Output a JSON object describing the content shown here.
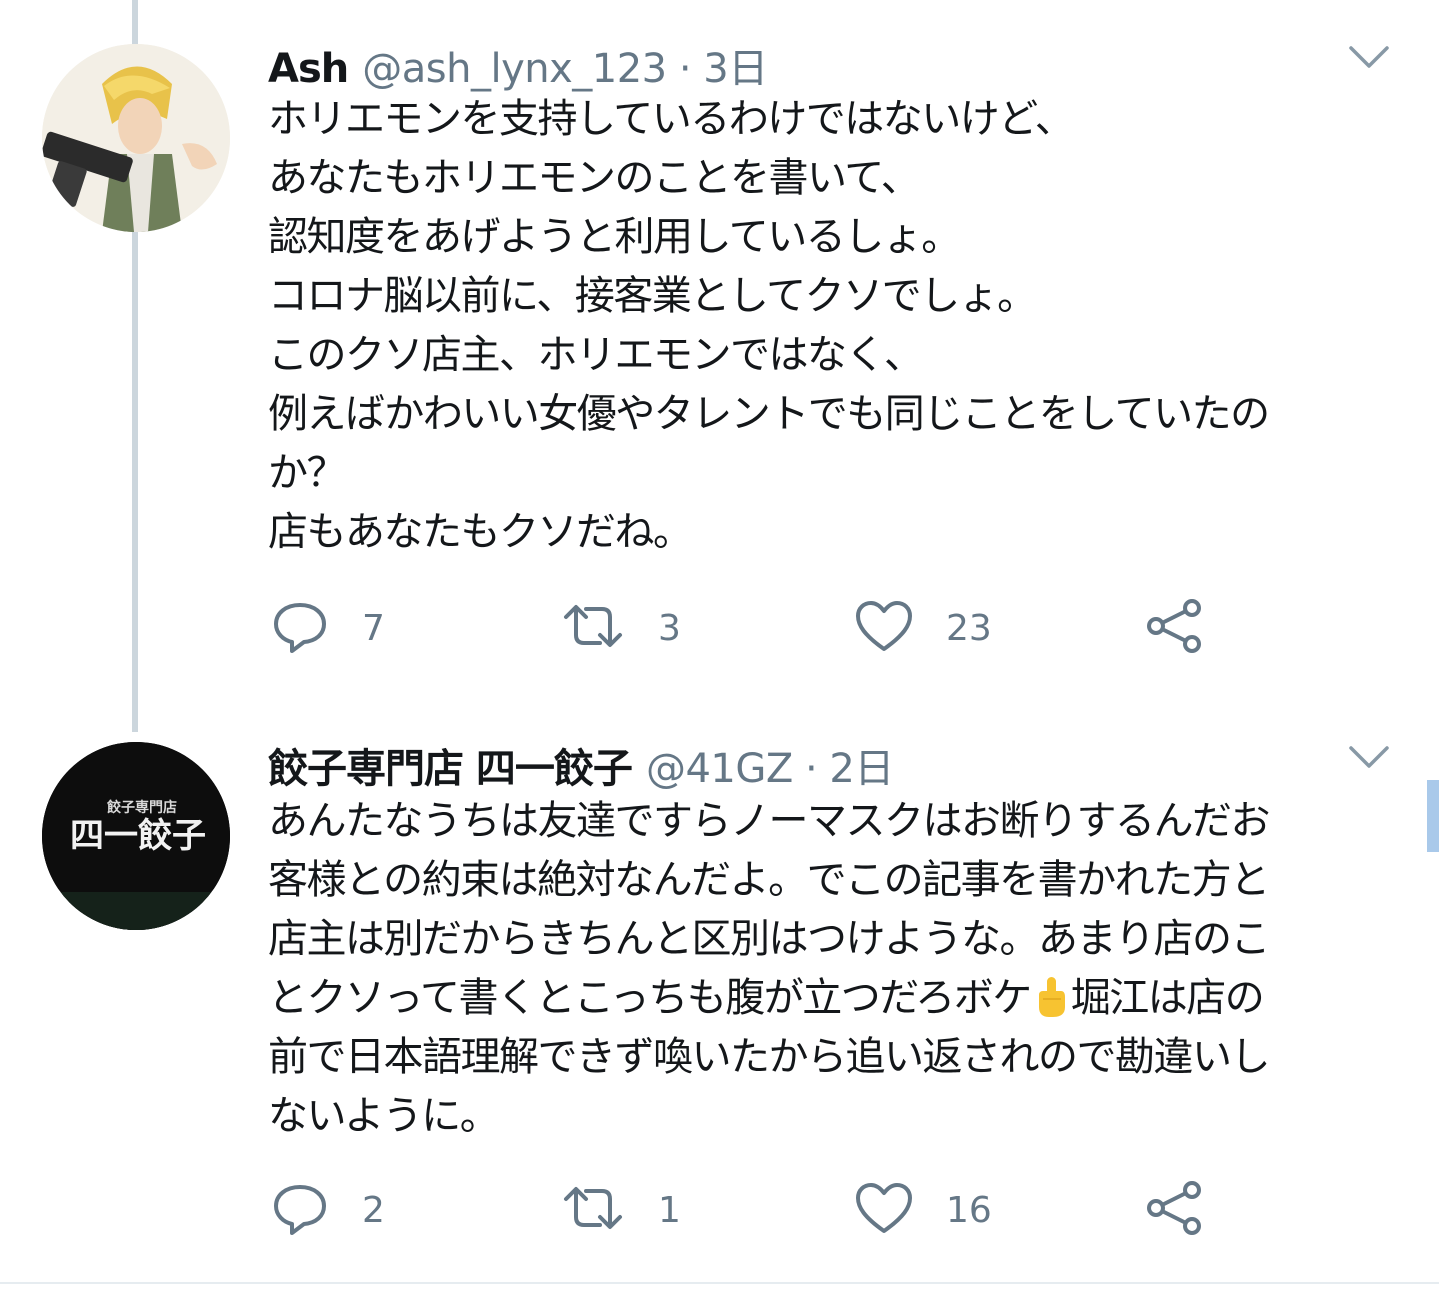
{
  "tweets": [
    {
      "name": "Ash",
      "handle": "@ash_lynx_123 · 3日",
      "text": "ホリエモンを支持しているわけではないけど、\nあなたもホリエモンのことを書いて、\n認知度をあげようと利用しているしょ。\nコロナ脳以前に、接客業としてクソでしょ。\nこのクソ店主、ホリエモンではなく、\n例えばかわいい女優やタレントでも同じことをしていたの\nか？\n店もあなたもクソだね。",
      "replies": "7",
      "retweets": "3",
      "likes": "23"
    },
    {
      "name": "餃子専門店 四一餃子",
      "handle": "@41GZ · 2日",
      "avatar_text_small": "餃子専門店",
      "avatar_text_big": "四一餃子",
      "text_before_emoji": "あんたなうちは友達ですらノーマスクはお断りするんだお\n客様との約束は絶対なんだよ。でこの記事を書かれた方と\n店主は別だからきちんと区別はつけような。あまり店のこ\nとクソって書くとこっちも腹が立つだろボケ",
      "text_after_emoji": "堀江は店の\n前で日本語理解できず喚いたから追い返されので勘違いし\nないように。",
      "replies": "2",
      "retweets": "1",
      "likes": "16"
    }
  ],
  "colors": {
    "text": "#14171a",
    "secondary": "#657786",
    "thread_line": "#ccd6dd",
    "scrollbar": "#a9c9ea"
  },
  "icons": [
    "reply-icon",
    "retweet-icon",
    "like-icon",
    "share-icon",
    "caret-down-icon",
    "middle-finger-emoji"
  ]
}
